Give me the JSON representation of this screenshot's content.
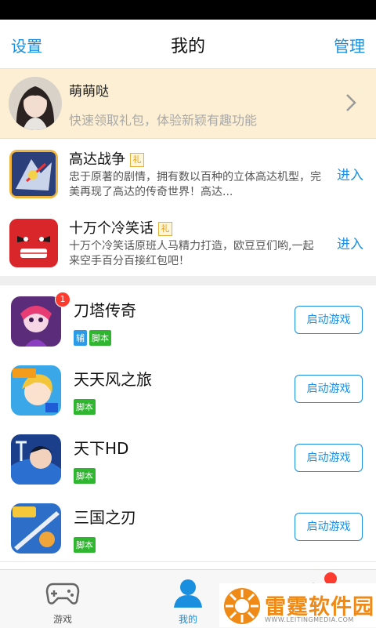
{
  "header": {
    "left": "设置",
    "title": "我的",
    "right": "管理"
  },
  "profile": {
    "name": "萌萌哒",
    "subtitle": "快速领取礼包，体验新颖有趣功能"
  },
  "promos": [
    {
      "title": "高达战争",
      "gift": "礼",
      "desc": "忠于原著的剧情，拥有数以百种的立体高达机型，完美再现了高达的传奇世界！高达...",
      "action": "进入"
    },
    {
      "title": "十万个冷笑话",
      "gift": "礼",
      "desc": "十万个冷笑话原班人马精力打造，欧豆豆们哟,一起来空手百分百接红包吧！",
      "action": "进入"
    }
  ],
  "games": [
    {
      "name": "刀塔传奇",
      "badge": "1",
      "tags": [
        "辅",
        "脚本"
      ],
      "button": "启动游戏"
    },
    {
      "name": "天天风之旅",
      "tags": [
        "脚本"
      ],
      "button": "启动游戏"
    },
    {
      "name": "天下HD",
      "tags": [
        "脚本"
      ],
      "button": "启动游戏"
    },
    {
      "name": "三国之刃",
      "tags": [
        "脚本"
      ],
      "button": "启动游戏"
    }
  ],
  "tabs": [
    {
      "label": "游戏",
      "icon": "gamepad-icon"
    },
    {
      "label": "我的",
      "icon": "user-icon"
    },
    {
      "label": "",
      "icon": "clock-icon"
    }
  ],
  "watermark": {
    "text": "雷霆软件园",
    "url": "WWW.LEITINGMEDIA.COM"
  },
  "colors": {
    "accent": "#1a8fe0",
    "profile_bg": "#fcefd3",
    "tag_green": "#2fb52f",
    "tag_blue": "#2b9be8",
    "badge_red": "#ff3b30"
  }
}
